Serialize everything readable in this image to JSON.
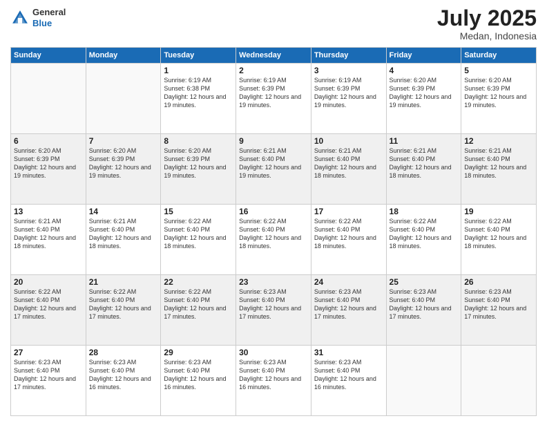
{
  "header": {
    "logo_general": "General",
    "logo_blue": "Blue",
    "month": "July 2025",
    "location": "Medan, Indonesia"
  },
  "weekdays": [
    "Sunday",
    "Monday",
    "Tuesday",
    "Wednesday",
    "Thursday",
    "Friday",
    "Saturday"
  ],
  "weeks": [
    [
      {
        "day": "",
        "info": ""
      },
      {
        "day": "",
        "info": ""
      },
      {
        "day": "1",
        "info": "Sunrise: 6:19 AM\nSunset: 6:38 PM\nDaylight: 12 hours and 19 minutes."
      },
      {
        "day": "2",
        "info": "Sunrise: 6:19 AM\nSunset: 6:39 PM\nDaylight: 12 hours and 19 minutes."
      },
      {
        "day": "3",
        "info": "Sunrise: 6:19 AM\nSunset: 6:39 PM\nDaylight: 12 hours and 19 minutes."
      },
      {
        "day": "4",
        "info": "Sunrise: 6:20 AM\nSunset: 6:39 PM\nDaylight: 12 hours and 19 minutes."
      },
      {
        "day": "5",
        "info": "Sunrise: 6:20 AM\nSunset: 6:39 PM\nDaylight: 12 hours and 19 minutes."
      }
    ],
    [
      {
        "day": "6",
        "info": "Sunrise: 6:20 AM\nSunset: 6:39 PM\nDaylight: 12 hours and 19 minutes."
      },
      {
        "day": "7",
        "info": "Sunrise: 6:20 AM\nSunset: 6:39 PM\nDaylight: 12 hours and 19 minutes."
      },
      {
        "day": "8",
        "info": "Sunrise: 6:20 AM\nSunset: 6:39 PM\nDaylight: 12 hours and 19 minutes."
      },
      {
        "day": "9",
        "info": "Sunrise: 6:21 AM\nSunset: 6:40 PM\nDaylight: 12 hours and 19 minutes."
      },
      {
        "day": "10",
        "info": "Sunrise: 6:21 AM\nSunset: 6:40 PM\nDaylight: 12 hours and 18 minutes."
      },
      {
        "day": "11",
        "info": "Sunrise: 6:21 AM\nSunset: 6:40 PM\nDaylight: 12 hours and 18 minutes."
      },
      {
        "day": "12",
        "info": "Sunrise: 6:21 AM\nSunset: 6:40 PM\nDaylight: 12 hours and 18 minutes."
      }
    ],
    [
      {
        "day": "13",
        "info": "Sunrise: 6:21 AM\nSunset: 6:40 PM\nDaylight: 12 hours and 18 minutes."
      },
      {
        "day": "14",
        "info": "Sunrise: 6:21 AM\nSunset: 6:40 PM\nDaylight: 12 hours and 18 minutes."
      },
      {
        "day": "15",
        "info": "Sunrise: 6:22 AM\nSunset: 6:40 PM\nDaylight: 12 hours and 18 minutes."
      },
      {
        "day": "16",
        "info": "Sunrise: 6:22 AM\nSunset: 6:40 PM\nDaylight: 12 hours and 18 minutes."
      },
      {
        "day": "17",
        "info": "Sunrise: 6:22 AM\nSunset: 6:40 PM\nDaylight: 12 hours and 18 minutes."
      },
      {
        "day": "18",
        "info": "Sunrise: 6:22 AM\nSunset: 6:40 PM\nDaylight: 12 hours and 18 minutes."
      },
      {
        "day": "19",
        "info": "Sunrise: 6:22 AM\nSunset: 6:40 PM\nDaylight: 12 hours and 18 minutes."
      }
    ],
    [
      {
        "day": "20",
        "info": "Sunrise: 6:22 AM\nSunset: 6:40 PM\nDaylight: 12 hours and 17 minutes."
      },
      {
        "day": "21",
        "info": "Sunrise: 6:22 AM\nSunset: 6:40 PM\nDaylight: 12 hours and 17 minutes."
      },
      {
        "day": "22",
        "info": "Sunrise: 6:22 AM\nSunset: 6:40 PM\nDaylight: 12 hours and 17 minutes."
      },
      {
        "day": "23",
        "info": "Sunrise: 6:23 AM\nSunset: 6:40 PM\nDaylight: 12 hours and 17 minutes."
      },
      {
        "day": "24",
        "info": "Sunrise: 6:23 AM\nSunset: 6:40 PM\nDaylight: 12 hours and 17 minutes."
      },
      {
        "day": "25",
        "info": "Sunrise: 6:23 AM\nSunset: 6:40 PM\nDaylight: 12 hours and 17 minutes."
      },
      {
        "day": "26",
        "info": "Sunrise: 6:23 AM\nSunset: 6:40 PM\nDaylight: 12 hours and 17 minutes."
      }
    ],
    [
      {
        "day": "27",
        "info": "Sunrise: 6:23 AM\nSunset: 6:40 PM\nDaylight: 12 hours and 17 minutes."
      },
      {
        "day": "28",
        "info": "Sunrise: 6:23 AM\nSunset: 6:40 PM\nDaylight: 12 hours and 16 minutes."
      },
      {
        "day": "29",
        "info": "Sunrise: 6:23 AM\nSunset: 6:40 PM\nDaylight: 12 hours and 16 minutes."
      },
      {
        "day": "30",
        "info": "Sunrise: 6:23 AM\nSunset: 6:40 PM\nDaylight: 12 hours and 16 minutes."
      },
      {
        "day": "31",
        "info": "Sunrise: 6:23 AM\nSunset: 6:40 PM\nDaylight: 12 hours and 16 minutes."
      },
      {
        "day": "",
        "info": ""
      },
      {
        "day": "",
        "info": ""
      }
    ]
  ]
}
